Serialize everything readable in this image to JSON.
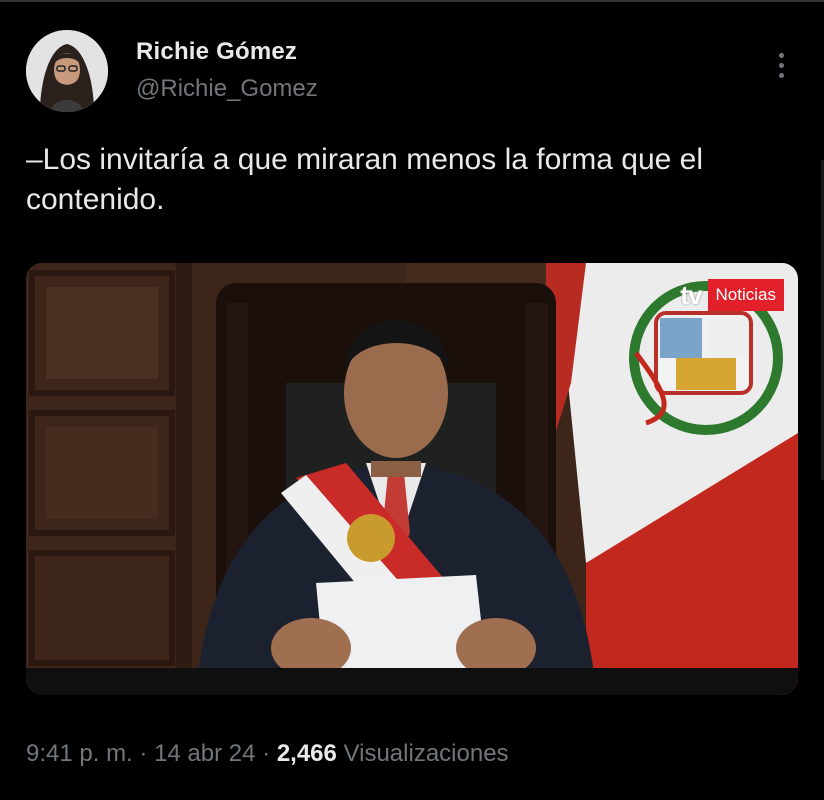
{
  "author": {
    "display_name": "Richie Gómez",
    "handle": "@Richie_Gomez"
  },
  "post": {
    "text": "–Los invitaría a que miraran menos la forma que el contenido."
  },
  "media": {
    "broadcaster_mark": "tv",
    "broadcaster_badge": "Noticias"
  },
  "meta": {
    "time": "9:41 p. m.",
    "separator1": " · ",
    "date": "14 abr 24",
    "separator2": " · ",
    "views_count": "2,466",
    "views_label": "Visualizaciones"
  },
  "icons": {
    "more": "more-vertical-icon"
  },
  "colors": {
    "background": "#000000",
    "primary_text": "#e7e9ea",
    "secondary_text": "#71767b",
    "badge_red": "#e2202a"
  }
}
